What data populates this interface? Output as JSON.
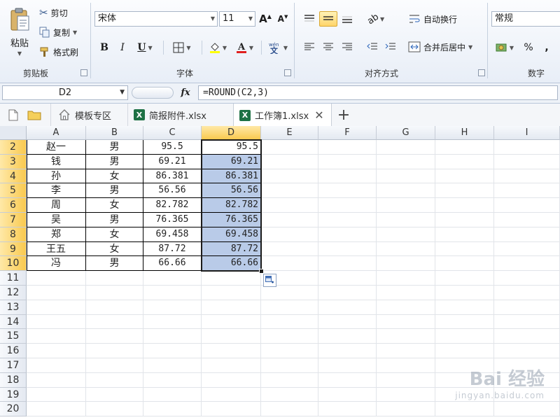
{
  "ribbon": {
    "clipboard": {
      "paste_label": "粘贴",
      "cut_label": "剪切",
      "copy_label": "复制",
      "format_painter_label": "格式刷",
      "group_label": "剪贴板"
    },
    "font": {
      "font_name": "宋体",
      "font_size": "11",
      "bold_label": "B",
      "italic_label": "I",
      "underline_label": "U",
      "group_label": "字体"
    },
    "alignment": {
      "wrap_text_label": "自动换行",
      "merge_center_label": "合并后居中",
      "group_label": "对齐方式"
    },
    "number": {
      "format": "常规",
      "percent_label": "%",
      "comma_label": ",",
      "group_label": "数字"
    }
  },
  "formula_bar": {
    "name_box": "D2",
    "fx_label": "fx",
    "formula": "=ROUND(C2,3)"
  },
  "tabs": [
    {
      "label": "模板专区"
    },
    {
      "label": "简报附件.xlsx"
    },
    {
      "label": "工作簿1.xlsx"
    }
  ],
  "columns": [
    "A",
    "B",
    "C",
    "D",
    "E",
    "F",
    "G",
    "H",
    "I"
  ],
  "rows": [
    "2",
    "3",
    "4",
    "5",
    "6",
    "7",
    "8",
    "9",
    "10",
    "11",
    "12",
    "13",
    "14",
    "15",
    "16",
    "17",
    "18",
    "19",
    "20"
  ],
  "table": [
    {
      "name": "赵一",
      "gender": "男",
      "raw": "95.5",
      "rounded": "95.5"
    },
    {
      "name": "钱",
      "gender": "男",
      "raw": "69.21",
      "rounded": "69.21"
    },
    {
      "name": "孙",
      "gender": "女",
      "raw": "86.381",
      "rounded": "86.381"
    },
    {
      "name": "李",
      "gender": "男",
      "raw": "56.56",
      "rounded": "56.56"
    },
    {
      "name": "周",
      "gender": "女",
      "raw": "82.782",
      "rounded": "82.782"
    },
    {
      "name": "吴",
      "gender": "男",
      "raw": "76.365",
      "rounded": "76.365"
    },
    {
      "name": "郑",
      "gender": "女",
      "raw": "69.458",
      "rounded": "69.458"
    },
    {
      "name": "王五",
      "gender": "女",
      "raw": "87.72",
      "rounded": "87.72"
    },
    {
      "name": "冯",
      "gender": "男",
      "raw": "66.66",
      "rounded": "66.66"
    }
  ],
  "watermark": {
    "brand": "Bai 经验",
    "url": "jingyan.baidu.com"
  }
}
